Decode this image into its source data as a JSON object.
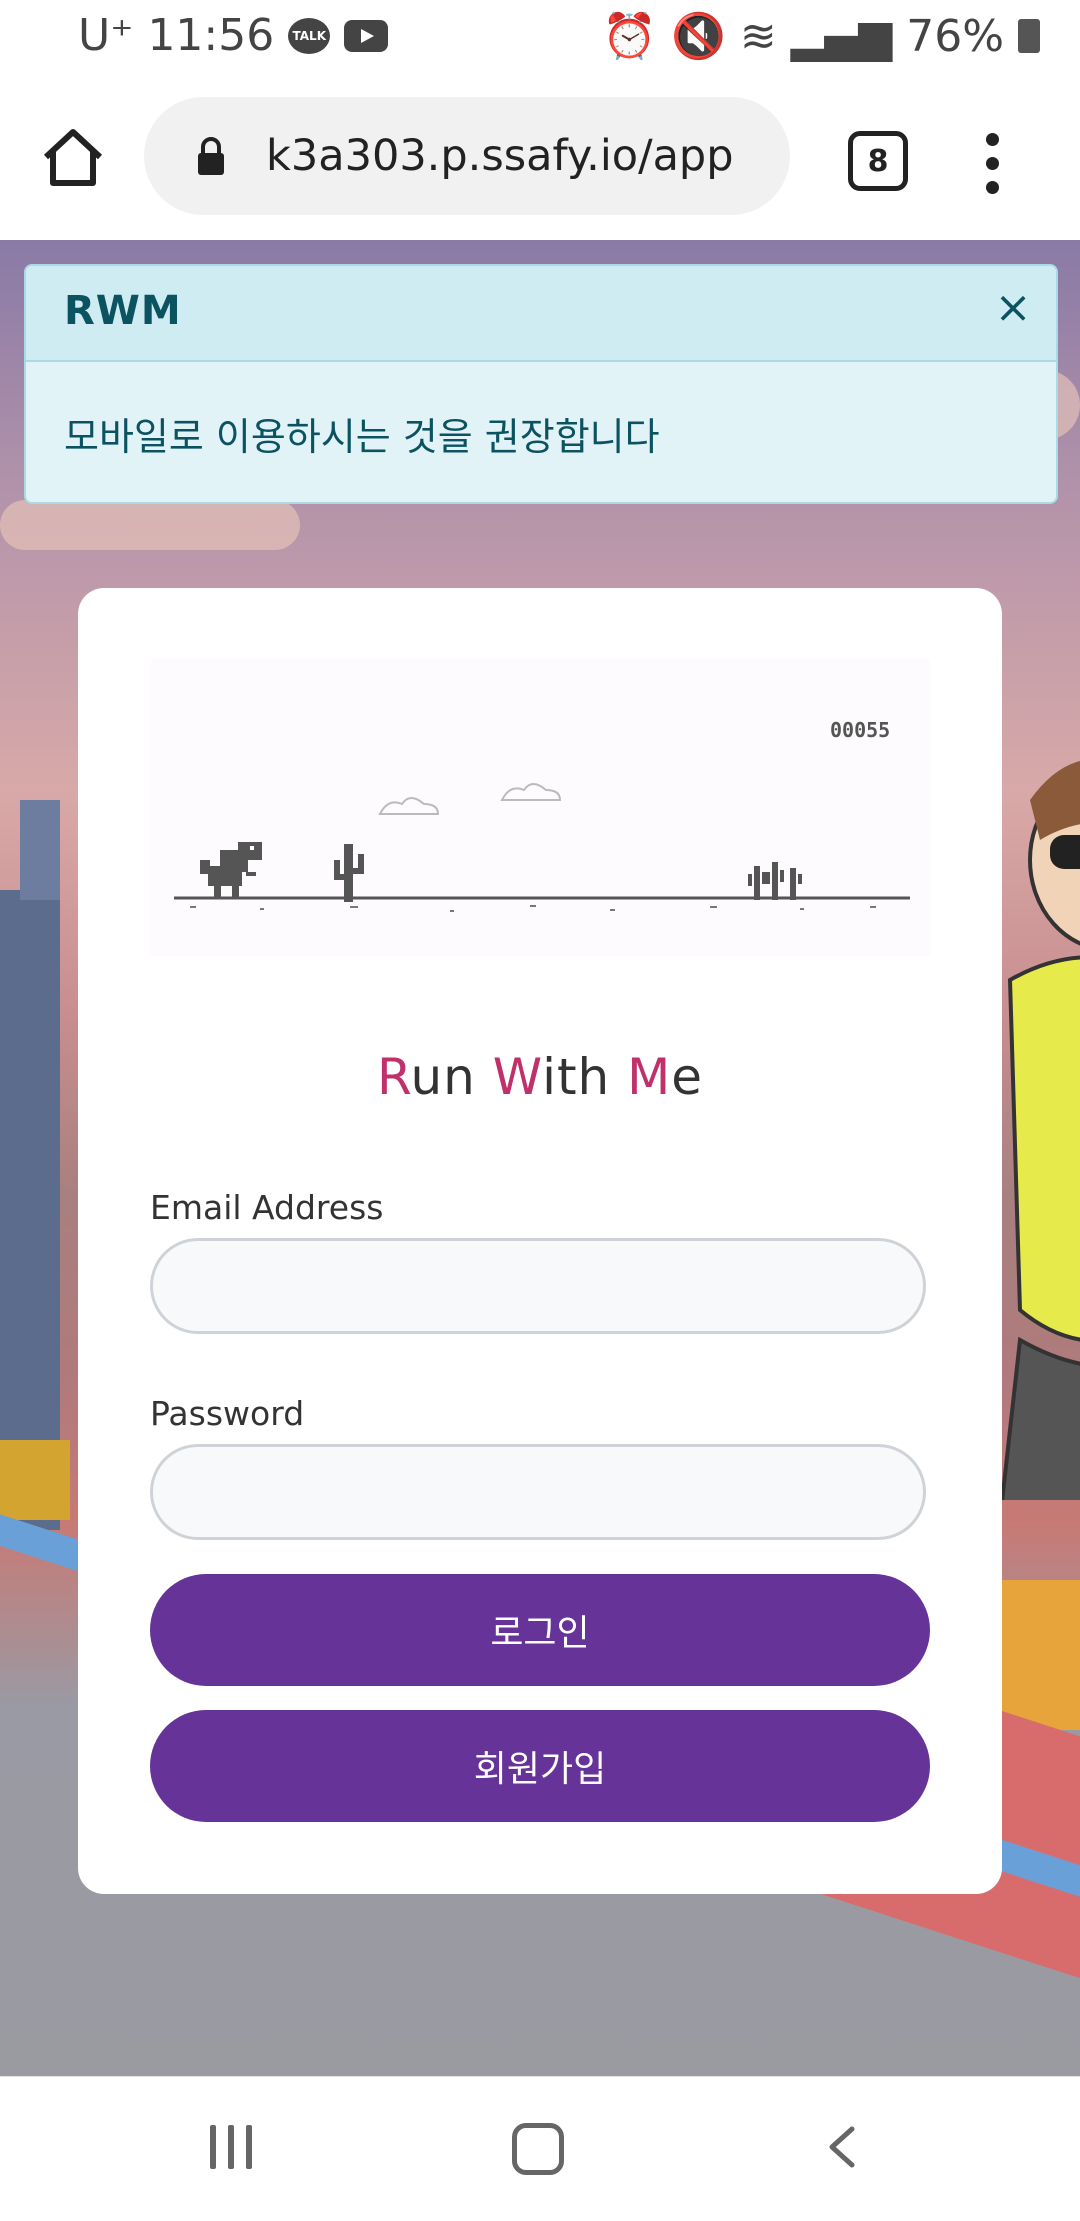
{
  "status_bar": {
    "carrier": "U⁺",
    "time": "11:56",
    "talk_badge": "TALK",
    "battery": "76%",
    "icons": [
      "kakaotalk-icon",
      "youtube-icon",
      "alarm-icon",
      "mute-icon",
      "wifi-icon",
      "signal-icon",
      "battery-icon"
    ]
  },
  "browser": {
    "url": "k3a303.p.ssafy.io/app",
    "tab_count": "8"
  },
  "alert": {
    "title": "RWM",
    "close": "×",
    "message": "모바일로 이용하시는 것을 권장합니다"
  },
  "game": {
    "score": "00055"
  },
  "brand": {
    "parts": [
      {
        "accent": "R",
        "rest": "un "
      },
      {
        "accent": "W",
        "rest": "ith "
      },
      {
        "accent": "M",
        "rest": "e"
      }
    ]
  },
  "form": {
    "email_label": "Email Address",
    "email_value": "",
    "password_label": "Password",
    "password_value": "",
    "login_button": "로그인",
    "signup_button": "회원가입"
  },
  "colors": {
    "primary": "#663399",
    "accent": "#c0306b",
    "alert_text": "#0b5361",
    "alert_bg": "#e2f3f7"
  }
}
